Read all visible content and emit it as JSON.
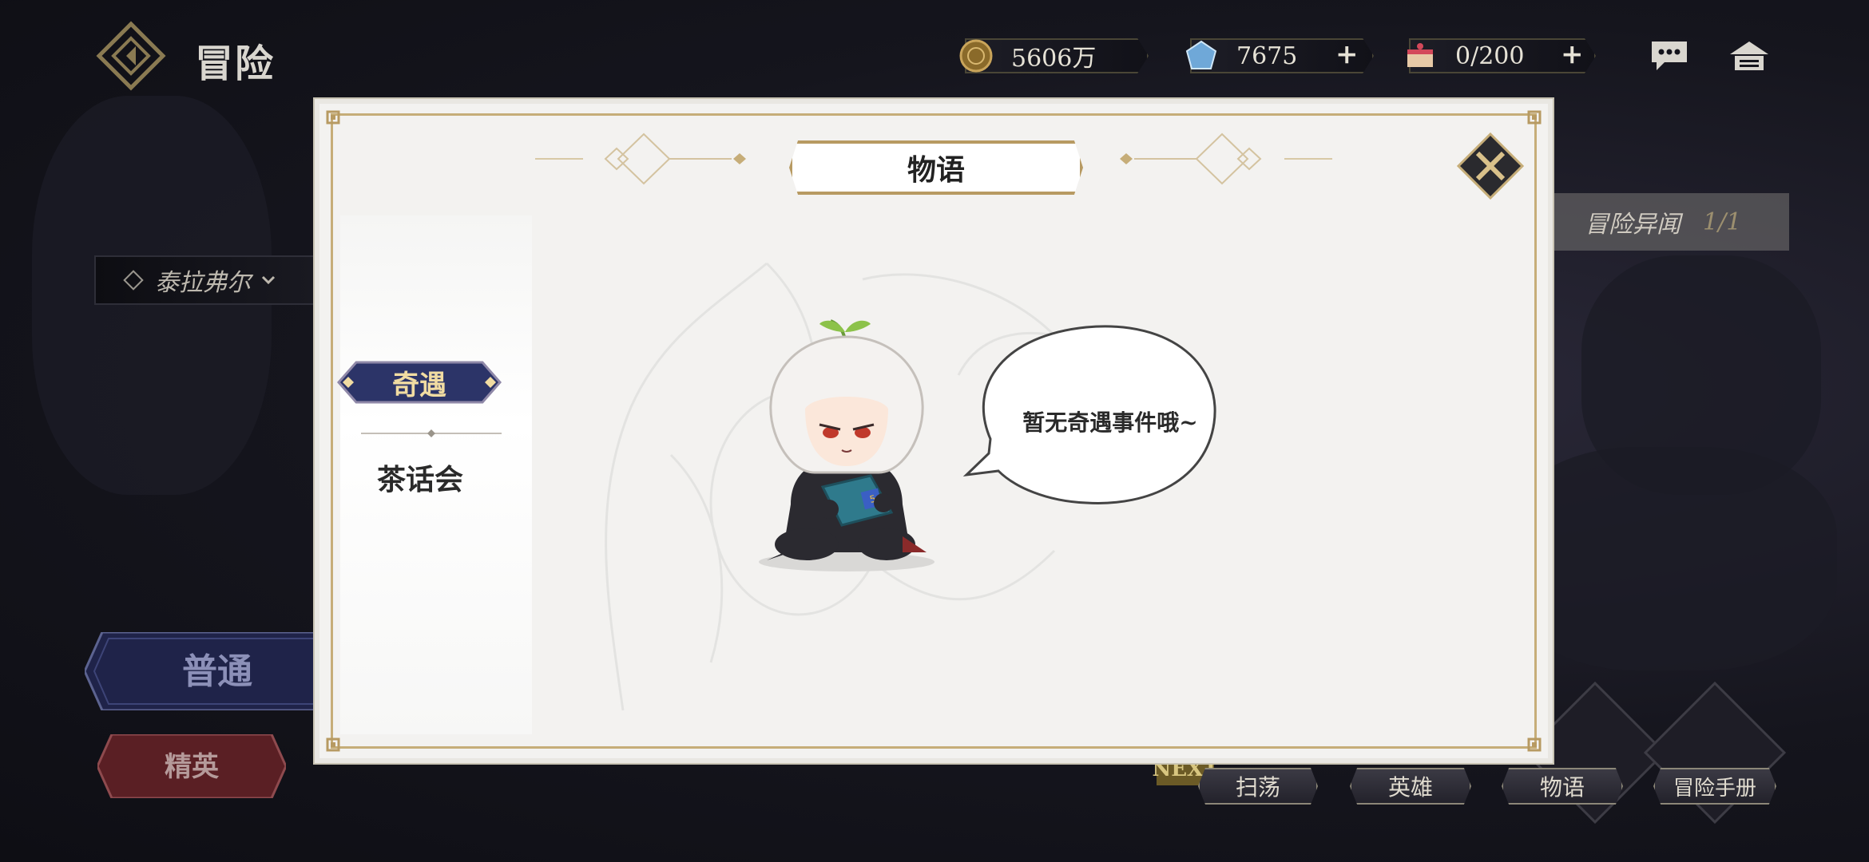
{
  "header": {
    "title": "冒险",
    "gold": "5606万",
    "gems": "7675",
    "stamina": "0/200",
    "plus": "+"
  },
  "left_panel": {
    "region": "泰拉弗尔",
    "normal": "普通",
    "elite": "精英"
  },
  "right_panel": {
    "odd_label": "冒险异闻",
    "odd_count": "1/1",
    "next_badge": "NEXT",
    "buttons": [
      "扫荡",
      "英雄",
      "物语",
      "冒险手册"
    ]
  },
  "modal": {
    "title": "物语",
    "tabs": [
      {
        "label": "奇遇",
        "active": true
      },
      {
        "label": "茶话会",
        "active": false
      }
    ],
    "empty_message": "暂无奇遇事件哦~"
  },
  "colors": {
    "gold_accent": "#c6ad78",
    "tab_navy": "#2c3468",
    "tab_text": "#f1dca2",
    "elite_red": "#6b2428"
  },
  "icons": [
    "logo-diamond-icon",
    "coin-icon",
    "gem-icon",
    "cake-icon",
    "chat-icon",
    "home-icon",
    "close-icon",
    "chevron-down-icon"
  ]
}
